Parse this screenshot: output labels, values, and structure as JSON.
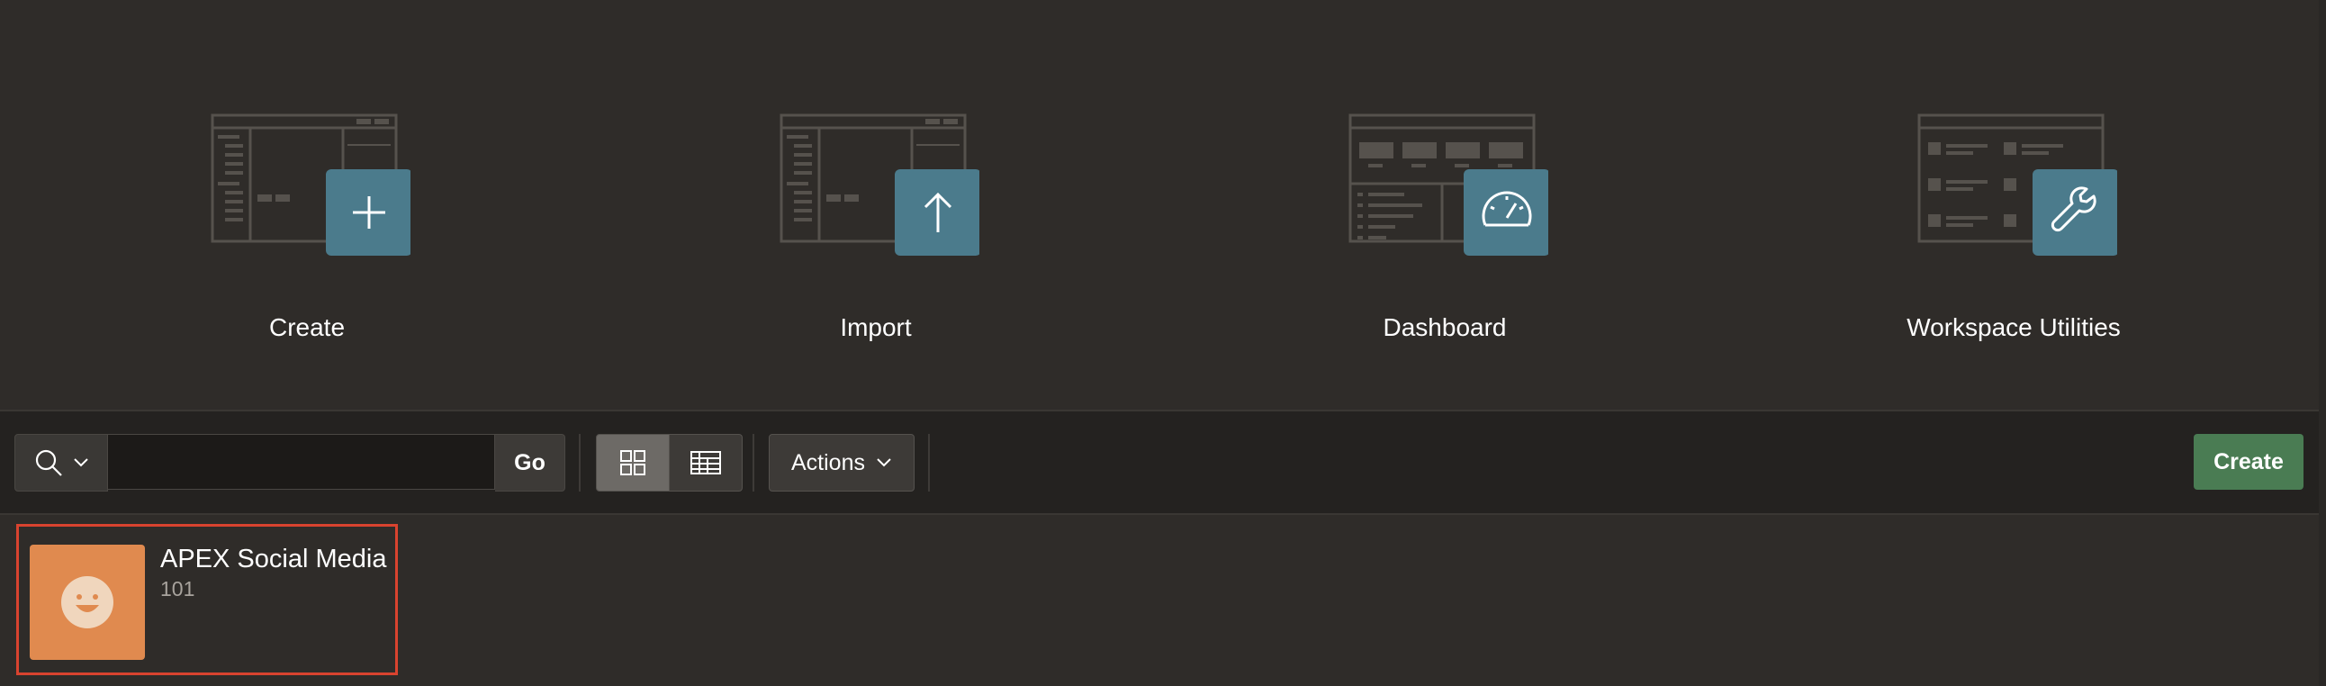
{
  "hero": {
    "cards": [
      {
        "label": "Create",
        "icon": "plus-icon"
      },
      {
        "label": "Import",
        "icon": "arrow-up-icon"
      },
      {
        "label": "Dashboard",
        "icon": "gauge-icon"
      },
      {
        "label": "Workspace Utilities",
        "icon": "wrench-icon"
      }
    ],
    "accent": "#4b7b8c"
  },
  "toolbar": {
    "search_value": "",
    "go_label": "Go",
    "actions_label": "Actions",
    "create_label": "Create",
    "create_color": "#4a7c53"
  },
  "apps": [
    {
      "name": "APEX Social Media",
      "number": "101",
      "color": "#e08a4f",
      "icon": "smiley-icon"
    }
  ]
}
